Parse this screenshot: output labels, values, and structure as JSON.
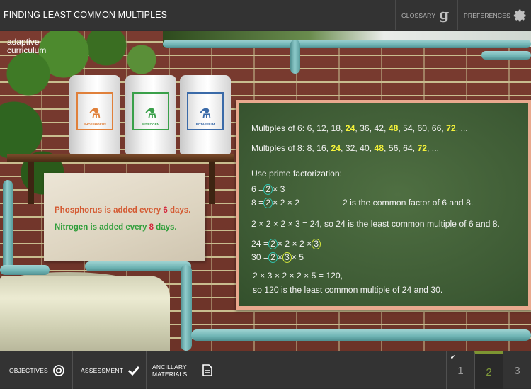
{
  "header": {
    "title": "FINDING LEAST COMMON MULTIPLES",
    "glossary_label": "GLOSSARY",
    "glossary_icon": "g",
    "preferences_label": "PREFERENCES"
  },
  "scene": {
    "logo_line1": "adaptive",
    "logo_line2": "curriculum",
    "jars": [
      {
        "label": "PHOSPHORUS",
        "color": "#e0803a"
      },
      {
        "label": "NITROGEN",
        "color": "#3aa04a"
      },
      {
        "label": "POTASSIUM",
        "color": "#3a6aa8"
      }
    ],
    "paper": {
      "line1_pre": "Phosphorus is added every ",
      "line1_num": "6",
      "line1_post": " days.",
      "line2_pre": "Nitrogen is added every ",
      "line2_num": "8",
      "line2_post": " days."
    }
  },
  "board": {
    "mult6": {
      "pre": "Multiples of 6: 6, 12, 18, ",
      "h1": "24",
      "m1": ", 36, 42, ",
      "h2": "48",
      "m2": ", 54, 60, 66, ",
      "h3": "72",
      "post": ", ..."
    },
    "mult8": {
      "pre": "Multiples of 8: 8, 16, ",
      "h1": "24",
      "m1": ", 32, 40, ",
      "h2": "48",
      "m2": ", 56, 64, ",
      "h3": "72",
      "post": ", ..."
    },
    "prime_heading": "Use prime factorization:",
    "f6": {
      "pre": "6 =",
      "c": "2",
      "post": "× 3"
    },
    "f8": {
      "pre": "8 =",
      "c": "2",
      "post": "× 2 × 2"
    },
    "common_note": "2 is the common factor of 6 and 8.",
    "lcm_6_8": "2 × 2 × 2 × 3 = 24, so 24 is the least common multiple of 6 and 8.",
    "f24": {
      "pre": "24 =",
      "c1": "2",
      "mid": "× 2 × 2 ×",
      "c2": "3"
    },
    "f30": {
      "pre": "30 =",
      "c1": "2",
      "mid": "×",
      "c2": "3",
      "post": "× 5"
    },
    "lcm_line1": "2 × 3 × 2 × 2 × 5 = 120,",
    "lcm_line2": "so 120 is the least common multiple of 24 and 30."
  },
  "footer": {
    "objectives_label": "OBJECTIVES",
    "assessment_label": "ASSESSMENT",
    "ancillary_line1": "ANCILLARY",
    "ancillary_line2": "MATERIALS",
    "pages": [
      "1",
      "2",
      "3"
    ],
    "current_page": "2",
    "completed_pages": [
      "1"
    ]
  },
  "colors": {
    "highlight": "#f4f23a",
    "current_page": "#7d9532",
    "board": "#3d5a34",
    "frame": "#e9a98e"
  }
}
